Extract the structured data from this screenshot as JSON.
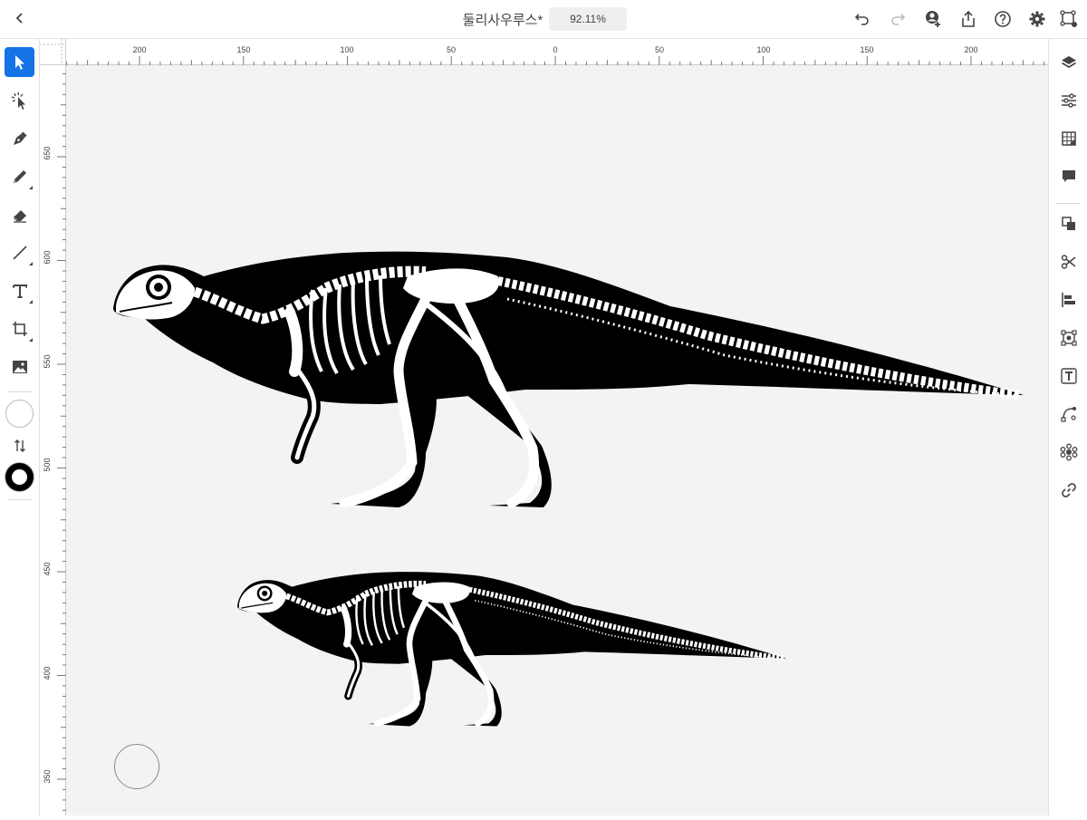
{
  "topbar": {
    "document_title": "둘리사우루스*",
    "zoom_level": "92.11%",
    "icons": [
      "chevron-left-icon",
      "undo-icon",
      "redo-icon",
      "invite-user-icon",
      "share-icon",
      "help-icon",
      "settings-icon",
      "cloud-doc-icon"
    ]
  },
  "left_toolbar": {
    "tools": [
      "selection-tool",
      "direct-selection-tool",
      "pen-tool",
      "pencil-tool",
      "eraser-tool",
      "line-tool",
      "type-tool",
      "shape-tool",
      "image-tool"
    ],
    "fill_swatch": "#ffffff",
    "stroke_swatch": "#000000"
  },
  "right_toolbar": {
    "panels": [
      "layers-icon",
      "properties-icon",
      "libraries-icon",
      "comments-icon",
      "arrange-icon",
      "scissors-icon",
      "align-icon",
      "transform-icon",
      "type-panel-icon",
      "path-icon",
      "pattern-icon",
      "link-icon"
    ]
  },
  "rulers": {
    "top_labels": [
      "200",
      "150",
      "100",
      "50",
      "0",
      "50",
      "100",
      "150",
      "200"
    ],
    "left_labels": [
      "650",
      "600",
      "550",
      "500",
      "450",
      "400",
      "350"
    ]
  },
  "colors": {
    "accent": "#1473e6",
    "canvas": "#f3f3f3",
    "silhouette": "#000000",
    "bone": "#ffffff"
  }
}
